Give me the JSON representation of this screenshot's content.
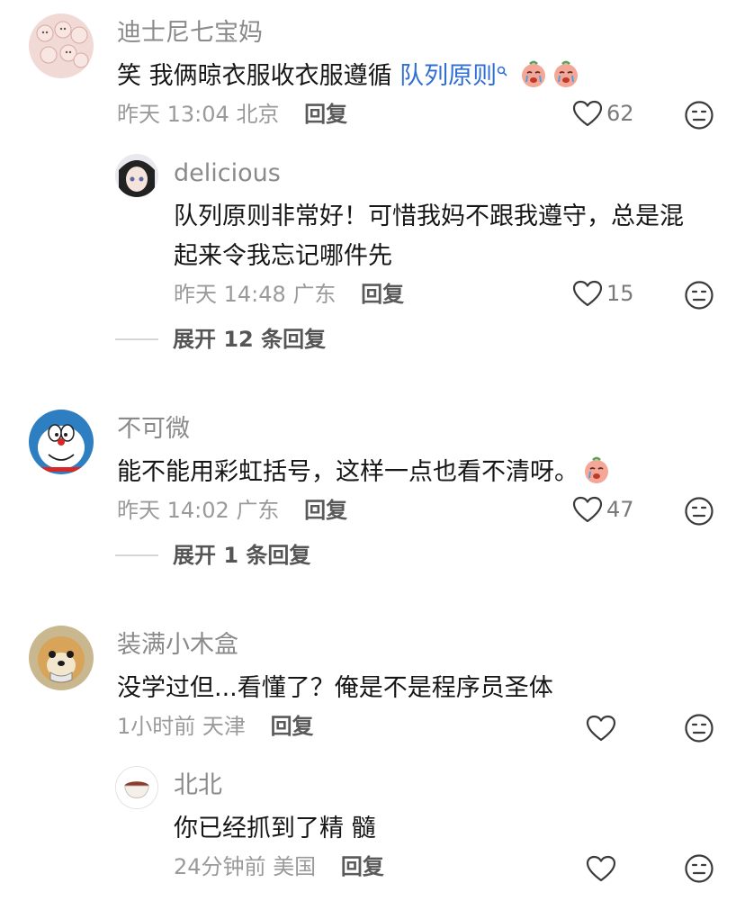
{
  "comments": [
    {
      "user": "迪士尼七宝妈",
      "text_prefix": "笑 我俩晾衣服收衣服遵循 ",
      "text_link": "队列原则",
      "time": "昨天 13:04",
      "location": "北京",
      "reply_label": "回复",
      "likes": "62",
      "avatar_icon": "cartoon-faces-avatar",
      "emoji_icon": "crying-face-emoji",
      "replies": [
        {
          "user": "delicious",
          "text_line1": "队列原则非常好！可惜我妈不跟我遵守，总是混",
          "text_line2": "起来令我忘记哪件先",
          "time": "昨天 14:48",
          "location": "广东",
          "reply_label": "回复",
          "likes": "15",
          "avatar_icon": "anime-girl-avatar"
        }
      ],
      "expand_label": "展开 12 条回复"
    },
    {
      "user": "不可微",
      "text": "能不能用彩虹括号，这样一点也看不清呀。",
      "time": "昨天 14:02",
      "location": "广东",
      "reply_label": "回复",
      "likes": "47",
      "avatar_icon": "doraemon-avatar",
      "emoji_icon": "crying-face-emoji",
      "expand_label": "展开 1 条回复"
    },
    {
      "user": "装满小木盒",
      "text": "没学过但...看懂了？俺是不是程序员圣体",
      "time": "1小时前",
      "location": "天津",
      "reply_label": "回复",
      "likes": "",
      "avatar_icon": "dog-avatar",
      "replies": [
        {
          "user": "北北",
          "text": "你已经抓到了精 髓",
          "time": "24分钟前",
          "location": "美国",
          "reply_label": "回复",
          "likes": "",
          "avatar_icon": "bowl-avatar"
        }
      ]
    }
  ],
  "colors": {
    "link": "#2f6fd4",
    "username": "#8a8a8a",
    "meta": "#9a9a9a"
  }
}
